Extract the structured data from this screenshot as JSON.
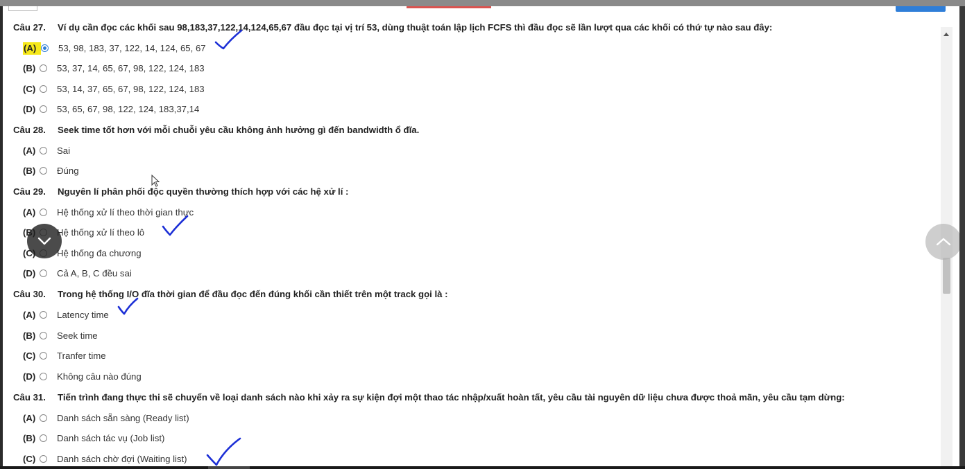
{
  "questions": [
    {
      "number": "Câu 27.",
      "text": "Ví dụ cần đọc các khối sau 98,183,37,122,14,124,65,67 đầu đọc tại vị trí 53, dùng thuật toán lập lịch FCFS thì đầu đọc sẽ lần lượt qua các khối có thứ tự nào sau đây:",
      "options": [
        {
          "letter": "(A)",
          "text": "53, 98, 183, 37, 122, 14, 124, 65, 67",
          "selected": true
        },
        {
          "letter": "(B)",
          "text": "53, 37, 14, 65, 67, 98, 122, 124, 183",
          "selected": false
        },
        {
          "letter": "(C)",
          "text": "53, 14, 37, 65, 67, 98, 122, 124, 183",
          "selected": false
        },
        {
          "letter": "(D)",
          "text": "53, 65, 67, 98, 122, 124, 183,37,14",
          "selected": false
        }
      ]
    },
    {
      "number": "Câu 28.",
      "text": "Seek time tốt hơn với mỗi chuỗi yêu cầu không ảnh hưởng gì đến bandwidth ổ đĩa.",
      "options": [
        {
          "letter": "(A)",
          "text": "Sai",
          "selected": false
        },
        {
          "letter": "(B)",
          "text": "Đúng",
          "selected": false
        }
      ]
    },
    {
      "number": "Câu 29.",
      "text": "Nguyên lí phân phối độc quyền thường thích hợp với các hệ xử lí :",
      "options": [
        {
          "letter": "(A)",
          "text": "Hệ thống xử lí theo thời gian thực",
          "selected": false
        },
        {
          "letter": "(B)",
          "text": "Hệ thống xử lí theo lô",
          "selected": false
        },
        {
          "letter": "(C)",
          "text": "Hệ thống đa chương",
          "selected": false
        },
        {
          "letter": "(D)",
          "text": "Cả A, B, C đều sai",
          "selected": false
        }
      ]
    },
    {
      "number": "Câu 30.",
      "text": "Trong hệ thống I/O đĩa thời gian để đầu đọc đến đúng khối cần thiết trên một track gọi là :",
      "options": [
        {
          "letter": "(A)",
          "text": "Latency time",
          "selected": false
        },
        {
          "letter": "(B)",
          "text": "Seek time",
          "selected": false
        },
        {
          "letter": "(C)",
          "text": "Tranfer time",
          "selected": false
        },
        {
          "letter": "(D)",
          "text": "Không câu nào đúng",
          "selected": false
        }
      ]
    },
    {
      "number": "Câu 31.",
      "text": "Tiến trình đang thực thi sẽ chuyển về loại danh sách nào khi xảy ra sự kiện đợi một thao tác nhập/xuất hoàn tất, yêu cầu tài nguyên dữ liệu chưa được thoả mãn, yêu cầu tạm dừng:",
      "options": [
        {
          "letter": "(A)",
          "text": "Danh sách sẵn sàng (Ready list)",
          "selected": false
        },
        {
          "letter": "(B)",
          "text": "Danh sách tác vụ (Job list)",
          "selected": false
        },
        {
          "letter": "(C)",
          "text": "Danh sách chờ đợi (Waiting list)",
          "selected": false
        }
      ]
    }
  ],
  "colors": {
    "accent": "#2f7ed8",
    "highlight": "#f6e81a",
    "pen_ink": "#1c2fd6"
  },
  "icons": {
    "scroll_down": "chevron-down-icon",
    "scroll_up": "chevron-up-icon"
  }
}
